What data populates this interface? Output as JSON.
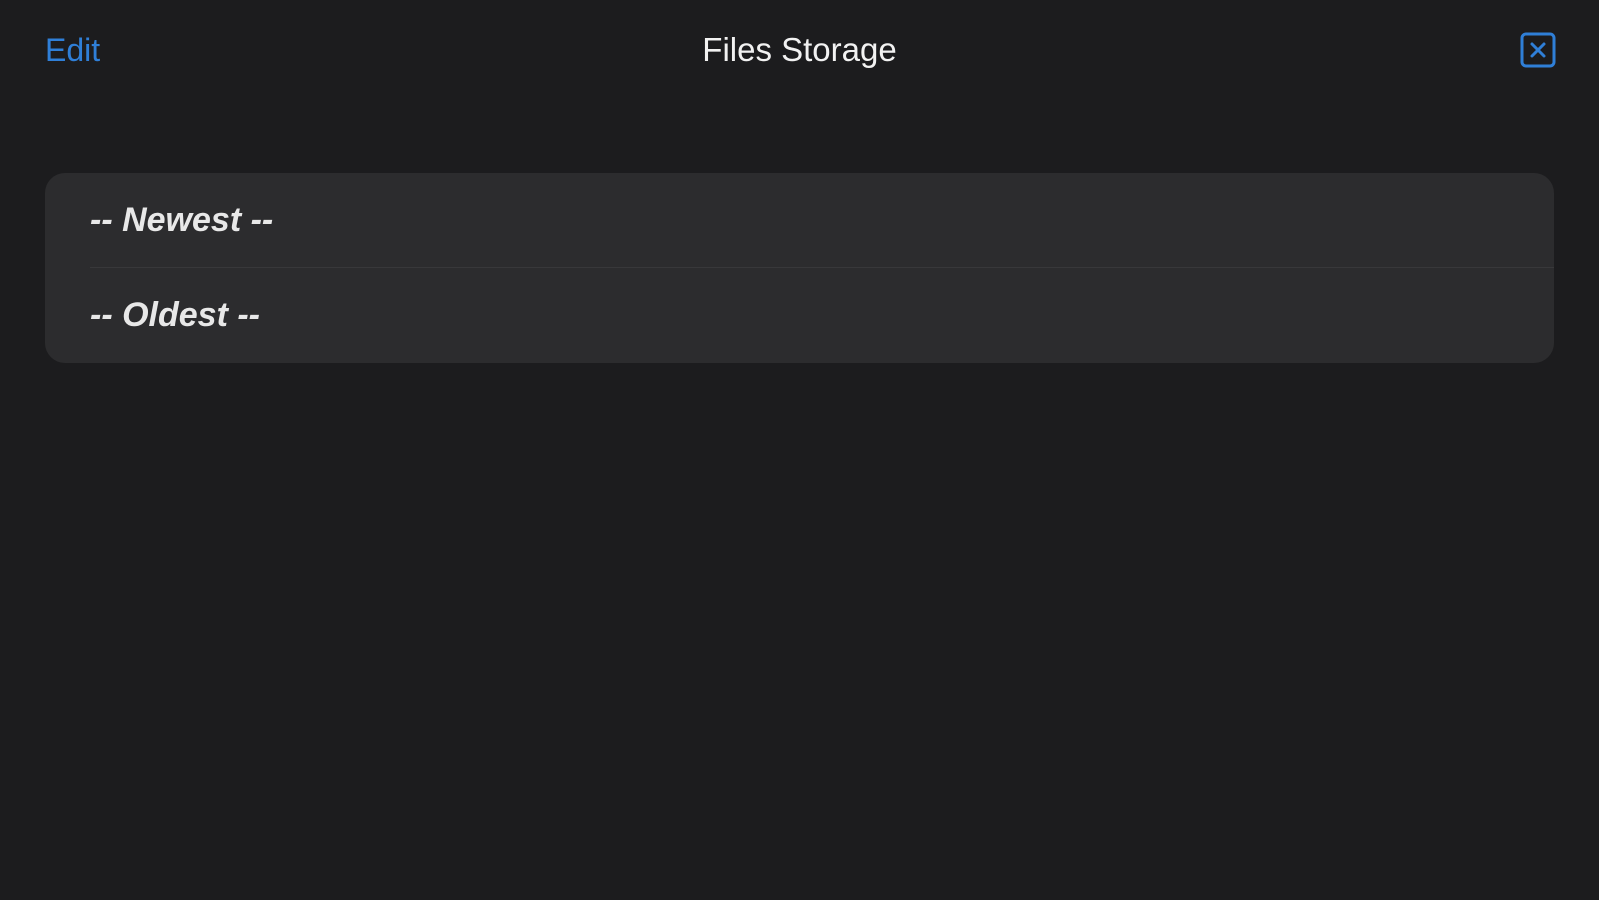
{
  "nav": {
    "edit_label": "Edit",
    "title": "Files Storage",
    "close_icon": "close-icon"
  },
  "sort_options": {
    "items": [
      {
        "label": "-- Newest --"
      },
      {
        "label": "-- Oldest --"
      }
    ]
  },
  "colors": {
    "background": "#1c1c1e",
    "card": "#2c2c2e",
    "accent": "#2f7fd8",
    "text": "#f2f2f2"
  }
}
